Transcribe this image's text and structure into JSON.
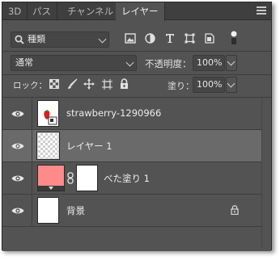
{
  "tabs": [
    {
      "label": "3D",
      "active": false
    },
    {
      "label": "パス",
      "active": false
    },
    {
      "label": "チャンネル",
      "active": false
    },
    {
      "label": "レイヤー",
      "active": true
    }
  ],
  "filter": {
    "kind_label": "種類",
    "icons": [
      "image-filter-icon",
      "adjustment-filter-icon",
      "text-filter-icon",
      "shape-filter-icon",
      "smartobject-filter-icon",
      "filter-toggle-icon"
    ]
  },
  "blend": {
    "mode": "通常",
    "opacity_label": "不透明度：",
    "opacity_value": "100%"
  },
  "lock": {
    "label": "ロック：",
    "icons": [
      "lock-transparent-icon",
      "lock-paint-icon",
      "lock-move-icon",
      "lock-artboard-icon",
      "lock-all-icon"
    ],
    "fill_label": "塗り：",
    "fill_value": "100%"
  },
  "layers": [
    {
      "name": "strawberry-1290966",
      "type": "smart-object",
      "selected": false
    },
    {
      "name": "レイヤー 1",
      "type": "empty",
      "selected": true
    },
    {
      "name": "べた塗り 1",
      "type": "fill",
      "selected": false,
      "fill_color": "#ff8a8a"
    },
    {
      "name": "背景",
      "type": "background",
      "selected": false,
      "locked": true
    }
  ],
  "colors": {
    "panel_bg": "#535353",
    "selected_row": "#6a6a6a",
    "fill_swatch": "#ff8a8a"
  }
}
